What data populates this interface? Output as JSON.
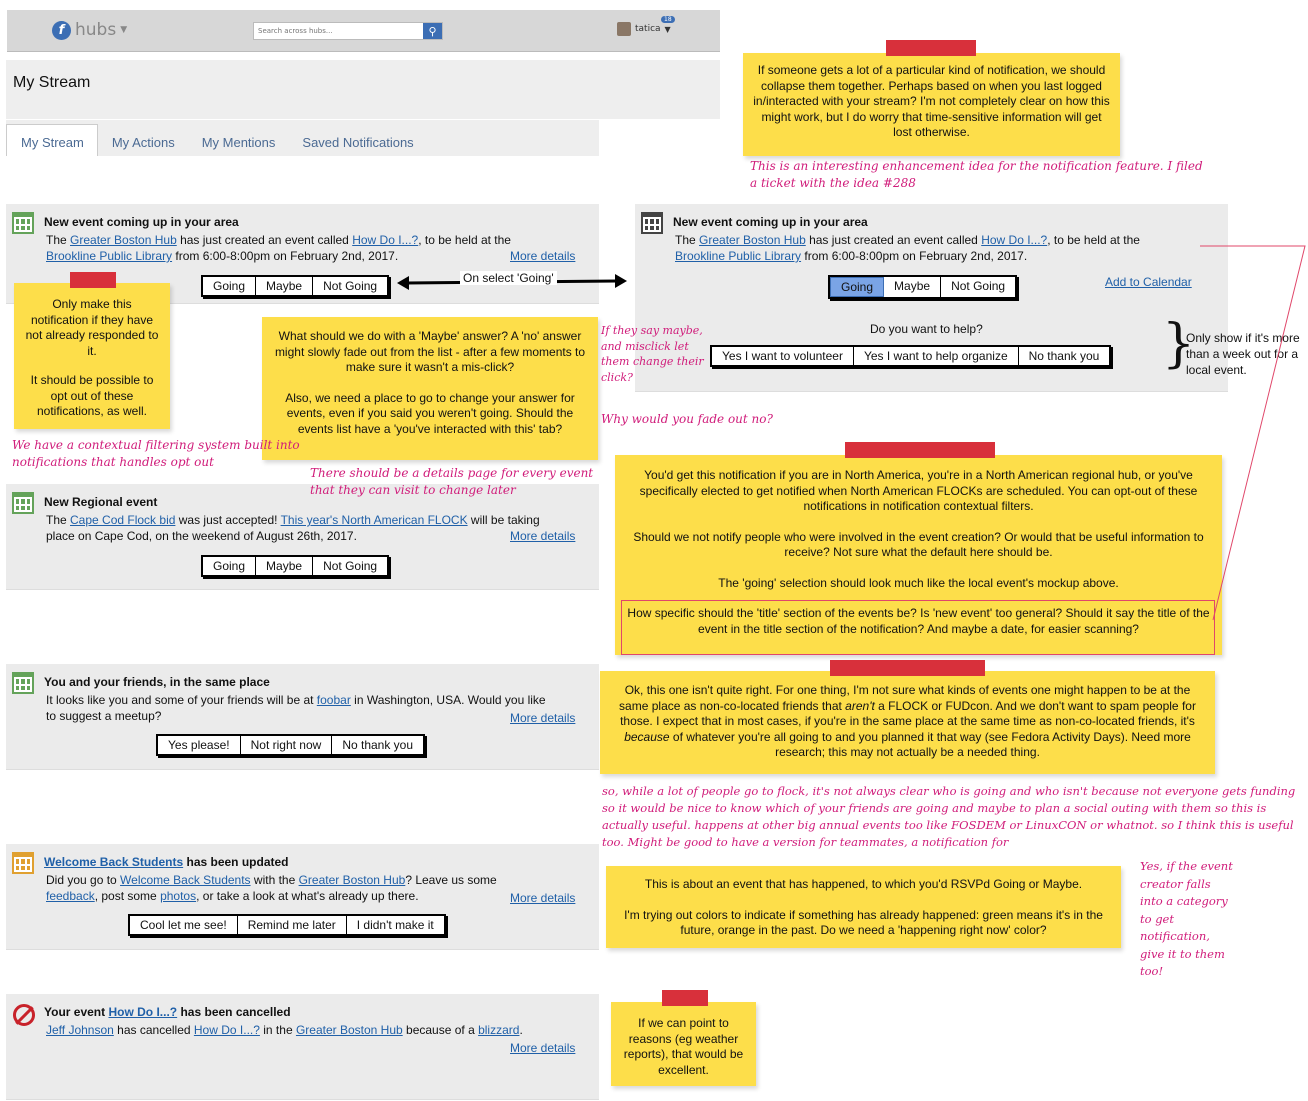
{
  "header": {
    "brand": "hubs",
    "search_placeholder": "Search across hubs...",
    "username": "tatica",
    "badge": "18"
  },
  "page_title": "My Stream",
  "tabs": [
    "My Stream",
    "My Actions",
    "My Mentions",
    "Saved Notifications"
  ],
  "cards": {
    "c1": {
      "title": "New event coming up in your area",
      "l1a": "The ",
      "hub": "Greater Boston Hub",
      "l1b": " has just created an event called ",
      "event": "How Do I...?",
      "l1c": ", to be held at the",
      "place": "Brookline Public Library",
      "l2": " from 6:00-8:00pm on February 2nd, 2017.",
      "more": "More details",
      "b1": "Going",
      "b2": "Maybe",
      "b3": "Not Going"
    },
    "c2": {
      "title": "New event coming up in your area",
      "l1a": "The ",
      "hub": "Greater Boston Hub",
      "l1b": " has just created an event called ",
      "event": "How Do I...?",
      "l1c": ", to be held at the",
      "place": "Brookline Public Library",
      "l2": " from 6:00-8:00pm on February 2nd, 2017.",
      "add": "Add to Calendar",
      "b1": "Going",
      "b2": "Maybe",
      "b3": "Not Going",
      "help_q": "Do you want to help?",
      "h1": "Yes I want to volunteer",
      "h2": "Yes I want to help organize",
      "h3": "No thank you"
    },
    "c3": {
      "title": "New Regional event",
      "l1a": "The ",
      "bid": "Cape Cod Flock bid",
      "l1b": " was just accepted! ",
      "flock": "This year's North American FLOCK",
      "l1c": " will be taking",
      "l2": "place on Cape Cod, on the weekend of August 26th, 2017.",
      "more": "More details",
      "b1": "Going",
      "b2": "Maybe",
      "b3": "Not Going"
    },
    "c4": {
      "title": "You and your friends, in the same place",
      "l1a": "It looks like you and some of your friends will be at ",
      "foobar": "foobar",
      "l1b": " in Washington, USA. Would you like",
      "l2": "to suggest a meetup?",
      "more": "More details",
      "b1": "Yes please!",
      "b2": "Not right now",
      "b3": "No thank you"
    },
    "c5": {
      "title_link": "Welcome Back Students",
      "title_rest": " has been updated",
      "l1a": "Did you go to ",
      "wbs": "Welcome Back Students",
      "l1b": " with the ",
      "hub": "Greater Boston Hub",
      "l1c": "? Leave us some",
      "fb": "feedback",
      "l2a": ", post some ",
      "photos": "photos",
      "l2b": ", or take a look at what's already up there.",
      "more": "More details",
      "b1": "Cool let me see!",
      "b2": "Remind me later",
      "b3": "I didn't make it"
    },
    "c6": {
      "title_a": "Your event ",
      "title_link": "How Do I...?",
      "title_b": " has been cancelled",
      "user": "Jeff Johnson",
      "l1a": " has cancelled ",
      "event": "How Do I...?",
      "l1b": " in the ",
      "hub": "Greater Boston Hub",
      "l1c": " because of a ",
      "reason": "blizzard",
      "l1d": ".",
      "more": "More details"
    }
  },
  "arrow_label": "On select 'Going'",
  "notes": {
    "n1": "If someone gets a lot of a particular kind of notification, we should collapse them together. Perhaps based on when you last logged in/interacted with your stream? I'm not completely clear on how this might work, but I do worry that time-sensitive information will get lost otherwise.",
    "n2a": "Only make this notification if they have not already responded to it.",
    "n2b": "It should be possible to opt out of these notifications, as well.",
    "n3a": "What should we do with a 'Maybe' answer? A 'no' answer might slowly fade out from the list  - after a few moments to make sure it wasn't a mis-click?",
    "n3b": "Also, we need a place to go to change your answer for events, even if you said you weren't going. Should the events list have a 'you've interacted with this' tab?",
    "n4a": "You'd get this notification if you are in North America, you're in a North American regional hub, or you've specifically elected to get notified when North American FLOCKs are scheduled. You can opt-out of these notifications in notification contextual filters.",
    "n4b": "Should we not notify people who were involved in the event creation? Or would that be useful information to receive? Not sure what the default here should be.",
    "n4c": "The 'going' selection should look much like the local event's mockup above.",
    "n4d": "How specific should the 'title' section of the events be? Is 'new event' too general? Should it say the title of the event in the title section of the notification? And maybe a date, for easier scanning?",
    "n5a": "Ok, this one isn't quite right. For one thing, I'm not sure what kinds of events one might happen to be at the same place as non-co-located friends that ",
    "n5em": "aren't",
    "n5b": " a FLOCK or FUDcon. And we don't want to spam people for those. I expect that in most cases, if you're in the same place at the same time as non-co-located friends, it's ",
    "n5em2": "because",
    "n5c": " of whatever you're all going to and you planned it that way (see Fedora Activity Days). Need more research; this may not actually be a needed thing.",
    "n6a": "This is about an event that has happened, to which you'd RSVPd Going or Maybe.",
    "n6b": "I'm trying out colors to indicate if something has already happened: green means it's in the future, orange in the past. Do we need a 'happening right now' color?",
    "n7": "If we can point to reasons (eg weather reports), that would be excellent.",
    "side": "Only show if it's more than a week out for a local event."
  },
  "hand": {
    "h1": "This is an interesting enhancement idea for the notification feature. I filed a ticket with the idea #288",
    "h2": "We have a contextual filtering system built into notifications that handles opt out",
    "h3": "There should be a details page for every event that they can visit to change later",
    "h4": "If they say maybe, and misclick let them change their click?",
    "h5": "Why would you fade out no?",
    "h6": "so, while a lot of people go to flock, it's not always clear who is going and who isn't because not everyone gets funding so it would be nice to know which of your friends are going and maybe to plan a social outing with them so this is actually useful. happens at other big annual events too like FOSDEM or LinuxCON or whatnot. so I think this is useful too. Might be good to have a version for teammates, a notification for",
    "h7": "Yes, if the event creator falls into a category to get notification, give it to them too!"
  }
}
